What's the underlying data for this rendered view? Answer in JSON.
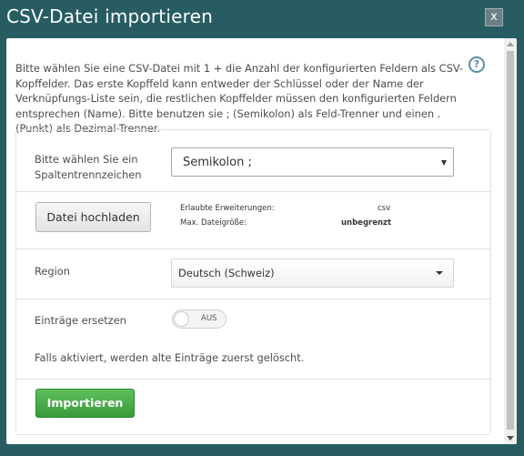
{
  "dialog": {
    "title": "CSV-Datei importieren",
    "close_label": "x",
    "intro": "Bitte wählen Sie eine CSV-Datei mit 1 + die Anzahl der konfigurierten Feldern als CSV-Kopffelder. Das erste Kopffeld kann entweder der Schlüssel oder der Name der Verknüpfungs-Liste sein, die restlichen Kopffelder müssen den konfigurierten Feldern entsprechen (Name). Bitte benutzen sie ; (Semikolon) als Feld-Trenner und einen . (Punkt) als Dezimal-Trenner.",
    "help_icon": "?"
  },
  "separator": {
    "label": "Bitte wählen Sie ein Spaltentrennzeichen",
    "selected": "Semikolon ;"
  },
  "upload": {
    "button_label": "Datei hochladen",
    "allowed_label": "Erlaubte Erweiterungen:",
    "allowed_value": "csv",
    "max_size_label": "Max. Dateigröße:",
    "max_size_value": "unbegrenzt"
  },
  "region": {
    "label": "Region",
    "selected": "Deutsch (Schweiz)"
  },
  "replace": {
    "label": "Einträge ersetzen",
    "toggle_state": "AUS",
    "hint": "Falls aktiviert, werden alte Einträge zuerst gelöscht."
  },
  "import_button_label": "Importieren",
  "colors": {
    "backdrop": "#1f4d52",
    "dialog": "#275d62",
    "import_button": "#4cae4c",
    "help_icon": "#5b8ea6"
  }
}
